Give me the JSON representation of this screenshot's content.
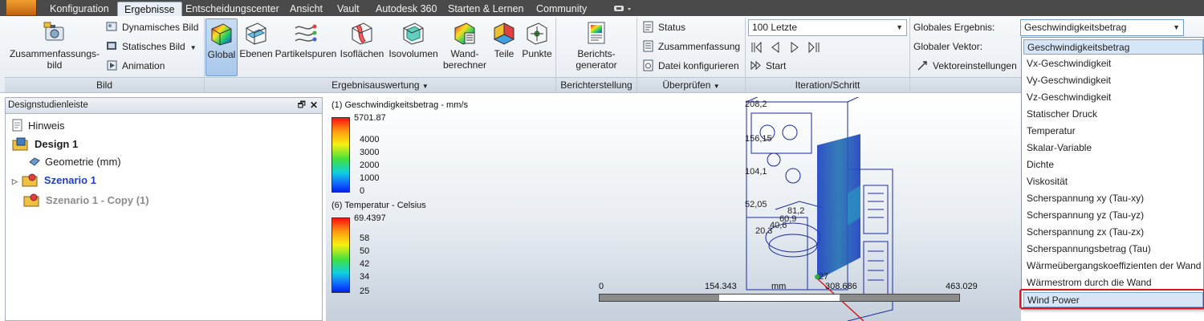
{
  "tabs": [
    "Konfiguration",
    "Ergebnisse",
    "Entscheidungscenter",
    "Ansicht",
    "Vault",
    "Autodesk 360",
    "Starten & Lernen",
    "Community"
  ],
  "ribbon": {
    "bild": {
      "panel_label": "Bild",
      "summary_btn": "Zusammenfassungs-\nbild",
      "dynamic_btn": "Dynamisches Bild",
      "static_btn": "Statisches Bild",
      "animation_btn": "Animation"
    },
    "auswertung": {
      "panel_label": "Ergebnisauswertung",
      "global": "Global",
      "ebenen": "Ebenen",
      "partikel": "Partikelspuren",
      "isoflaechen": "Isoflächen",
      "isovolumen": "Isovolumen",
      "wand": "Wand-\nberechner",
      "teile": "Teile",
      "punkte": "Punkte"
    },
    "bericht": {
      "panel_label": "Berichterstellung",
      "btn": "Berichts-\ngenerator"
    },
    "pruefen": {
      "panel_label": "Überprüfen",
      "status": "Status",
      "zusammenfassung": "Zusammenfassung",
      "datei": "Datei konfigurieren"
    },
    "iteration": {
      "panel_label": "Iteration/Schritt",
      "combo_value": "100 Letzte",
      "start": "Start"
    },
    "global": {
      "ergebnis_label": "Globales Ergebnis:",
      "ergebnis_value": "Geschwindigkeitsbetrag",
      "vektor_label": "Globaler Vektor:",
      "vektor_btn": "Vektoreinstellungen"
    }
  },
  "dropdown_items": [
    "Geschwindigkeitsbetrag",
    "Vx-Geschwindigkeit",
    "Vy-Geschwindigkeit",
    "Vz-Geschwindigkeit",
    "Statischer Druck",
    "Temperatur",
    "Skalar-Variable",
    "Dichte",
    "Viskosität",
    "Scherspannung xy (Tau-xy)",
    "Scherspannung yz (Tau-yz)",
    "Scherspannung zx (Tau-zx)",
    "Scherspannungsbetrag (Tau)",
    "Wärmeübergangskoeffizienten der Wand",
    "Wärmestrom durch die Wand",
    "Wind Power"
  ],
  "sidebar": {
    "title": "Designstudienleiste",
    "items": [
      "Hinweis",
      "Design 1",
      "Geometrie (mm)",
      "Szenario 1",
      "Szenario 1 - Copy (1)"
    ]
  },
  "viewport": {
    "legend1": {
      "title": "(1) Geschwindigkeitsbetrag - mm/s",
      "values": [
        "5701.87",
        "4000",
        "3000",
        "2000",
        "1000",
        "0"
      ]
    },
    "legend2": {
      "title": "(6) Temperatur - Celsius",
      "values": [
        "69.4397",
        "58",
        "50",
        "42",
        "34",
        "25"
      ]
    },
    "scale": {
      "ticks": [
        "0",
        "154.343",
        "308.686",
        "463.029"
      ],
      "unit": "mm"
    },
    "node_labels": [
      "208,2",
      "156,15",
      "104,1",
      "52,05",
      "81,2",
      "60,9",
      "40,6",
      "20,3",
      "27"
    ]
  },
  "colors": {
    "accent": "#6e9bd0",
    "highlight_box": "#e0141c"
  }
}
